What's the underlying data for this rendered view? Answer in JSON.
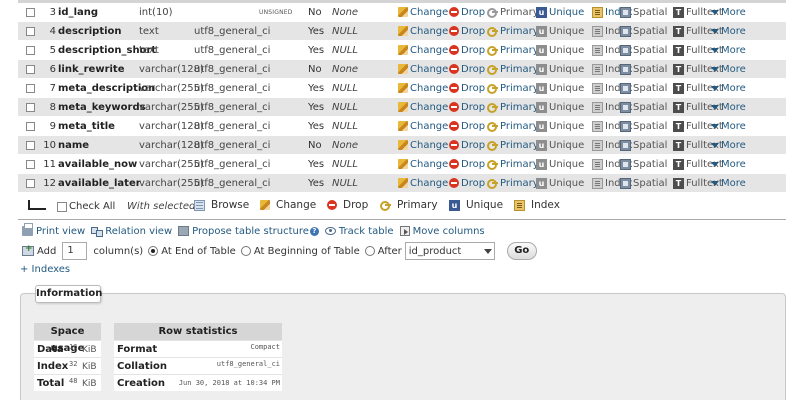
{
  "table_rows": [
    {
      "num": "3",
      "name": "id_lang",
      "type": "int(10)",
      "collation": "",
      "attributes": "UNSIGNED",
      "null": "No",
      "default": "None"
    },
    {
      "num": "4",
      "name": "description",
      "type": "text",
      "collation": "utf8_general_ci",
      "attributes": "",
      "null": "Yes",
      "default": "NULL"
    },
    {
      "num": "5",
      "name": "description_short",
      "type": "text",
      "collation": "utf8_general_ci",
      "attributes": "",
      "null": "Yes",
      "default": "NULL"
    },
    {
      "num": "6",
      "name": "link_rewrite",
      "type": "varchar(128)",
      "collation": "utf8_general_ci",
      "attributes": "",
      "null": "No",
      "default": "None"
    },
    {
      "num": "7",
      "name": "meta_description",
      "type": "varchar(255)",
      "collation": "utf8_general_ci",
      "attributes": "",
      "null": "Yes",
      "default": "NULL"
    },
    {
      "num": "8",
      "name": "meta_keywords",
      "type": "varchar(255)",
      "collation": "utf8_general_ci",
      "attributes": "",
      "null": "Yes",
      "default": "NULL"
    },
    {
      "num": "9",
      "name": "meta_title",
      "type": "varchar(128)",
      "collation": "utf8_general_ci",
      "attributes": "",
      "null": "Yes",
      "default": "NULL"
    },
    {
      "num": "10",
      "name": "name",
      "type": "varchar(128)",
      "collation": "utf8_general_ci",
      "attributes": "",
      "null": "No",
      "default": "None"
    },
    {
      "num": "11",
      "name": "available_now",
      "type": "varchar(255)",
      "collation": "utf8_general_ci",
      "attributes": "",
      "null": "Yes",
      "default": "NULL"
    },
    {
      "num": "12",
      "name": "available_later",
      "type": "varchar(255)",
      "collation": "utf8_general_ci",
      "attributes": "",
      "null": "Yes",
      "default": "NULL"
    }
  ],
  "row_actions": {
    "change": "Change",
    "drop": "Drop",
    "primary": "Primary",
    "unique": "Unique",
    "index": "Index",
    "spatial": "Spatial",
    "fulltext": "Fulltext",
    "more": "More"
  },
  "bulk": {
    "check_all": "Check All",
    "with_selected": "With selected:",
    "browse": "Browse",
    "change": "Change",
    "drop": "Drop",
    "primary": "Primary",
    "unique": "Unique",
    "index": "Index"
  },
  "links": {
    "print_view": "Print view",
    "relation_view": "Relation view",
    "propose_structure": "Propose table structure",
    "track_table": "Track table",
    "move_columns": "Move columns"
  },
  "add_columns": {
    "label": "Add",
    "count": "1",
    "columns_label": "column(s)",
    "at_end": "At End of Table",
    "at_beginning": "At Beginning of Table",
    "after": "After",
    "after_selected": "id_product",
    "go": "Go"
  },
  "indexes_link": "+ Indexes",
  "information": {
    "legend": "Information",
    "space_usage": {
      "title": "Space usage",
      "rows": [
        {
          "label": "Data",
          "value": "16",
          "unit": "KiB"
        },
        {
          "label": "Index",
          "value": "32",
          "unit": "KiB"
        },
        {
          "label": "Total",
          "value": "48",
          "unit": "KiB"
        }
      ]
    },
    "row_statistics": {
      "title": "Row statistics",
      "rows": [
        {
          "label": "Format",
          "value": "Compact"
        },
        {
          "label": "Collation",
          "value": "utf8_general_ci"
        },
        {
          "label": "Creation",
          "value": "Jun 30, 2018 at 10:34 PM"
        }
      ]
    }
  },
  "colors": {
    "link": "#235a81",
    "row_alt": "#e5e5e5",
    "panel_bg": "#eeeeee"
  }
}
